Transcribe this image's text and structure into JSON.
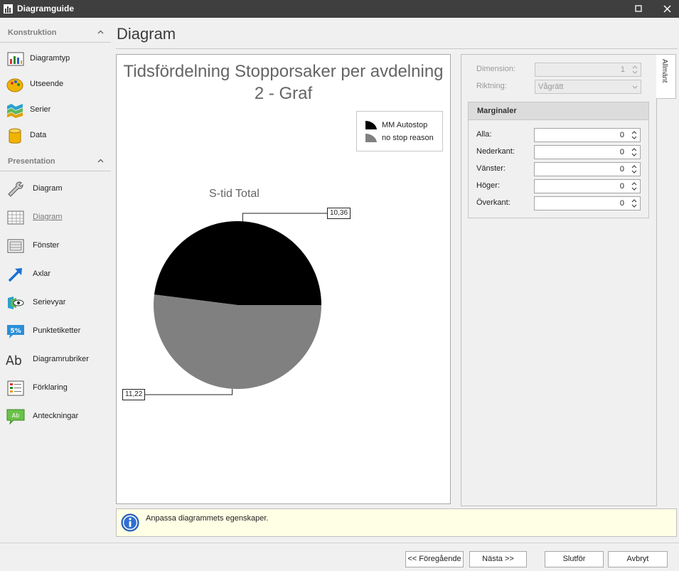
{
  "window": {
    "title": "Diagramguide",
    "controls": {
      "maximize": "maximize-icon",
      "close": "close-icon"
    }
  },
  "sidebar": {
    "groups": [
      {
        "label": "Konstruktion",
        "items": [
          {
            "label": "Diagramtyp",
            "icon": "chart-type-icon"
          },
          {
            "label": "Utseende",
            "icon": "palette-icon"
          },
          {
            "label": "Serier",
            "icon": "series-icon"
          },
          {
            "label": "Data",
            "icon": "database-icon"
          }
        ]
      },
      {
        "label": "Presentation",
        "items": [
          {
            "label": "Diagram",
            "icon": "wrench-icon"
          },
          {
            "label": "Diagram",
            "icon": "grid-icon",
            "active": true
          },
          {
            "label": "Fönster",
            "icon": "window-icon"
          },
          {
            "label": "Axlar",
            "icon": "axis-arrow-icon"
          },
          {
            "label": "Serievyar",
            "icon": "series-view-icon"
          },
          {
            "label": "Punktetiketter",
            "icon": "point-label-icon"
          },
          {
            "label": "Diagramrubriker",
            "icon": "title-text-icon"
          },
          {
            "label": "Förklaring",
            "icon": "legend-icon"
          },
          {
            "label": "Anteckningar",
            "icon": "annotation-icon"
          }
        ]
      }
    ]
  },
  "page": {
    "title": "Diagram"
  },
  "chart_data": {
    "type": "pie",
    "title": "Tidsfördelning Stopporsaker per avdelning 2 - Graf",
    "title_lines": [
      "Tidsfördelning Stopporsaker per avdelning",
      "2 - Graf"
    ],
    "series_title": "S-tid Total",
    "slices": [
      {
        "name": "MM Autostop",
        "value": 10.36,
        "label": "10,36",
        "color": "#000000"
      },
      {
        "name": "no stop reason",
        "value": 11.22,
        "label": "11,22",
        "color": "#808080"
      }
    ],
    "legend": {
      "position": "top-right",
      "entries": [
        "MM Autostop",
        "no stop reason"
      ]
    }
  },
  "properties": {
    "tab_label": "Allmänt",
    "dimension": {
      "label": "Dimension:",
      "value": "1"
    },
    "direction": {
      "label": "Riktning:",
      "value": "Vågrätt"
    },
    "margins": {
      "title": "Marginaler",
      "fields": [
        {
          "label": "Alla:",
          "value": "0"
        },
        {
          "label": "Nederkant:",
          "value": "0"
        },
        {
          "label": "Vänster:",
          "value": "0"
        },
        {
          "label": "Höger:",
          "value": "0"
        },
        {
          "label": "Överkant:",
          "value": "0"
        }
      ]
    }
  },
  "info": {
    "message": "Anpassa diagrammets egenskaper."
  },
  "buttons": {
    "previous": "<< Föregående",
    "next": "Nästa >>",
    "finish": "Slutför",
    "cancel": "Avbryt"
  },
  "colors": {
    "titlebar": "#3f3f3f",
    "info_background": "#ffffe6",
    "slice_1": "#000000",
    "slice_2": "#808080"
  }
}
